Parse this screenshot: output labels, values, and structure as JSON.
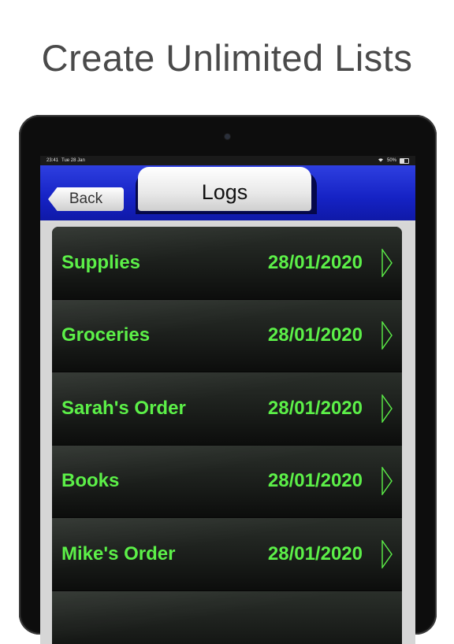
{
  "headline": "Create Unlimited Lists",
  "status_bar": {
    "time": "23:41",
    "date": "Tue 28 Jan",
    "battery": "50%",
    "icons": [
      "wifi-icon",
      "battery-icon"
    ]
  },
  "nav": {
    "back_label": "Back",
    "title": "Logs"
  },
  "lists": [
    {
      "name": "Supplies",
      "date": "28/01/2020"
    },
    {
      "name": "Groceries",
      "date": "28/01/2020"
    },
    {
      "name": "Sarah's Order",
      "date": "28/01/2020"
    },
    {
      "name": "Books",
      "date": "28/01/2020"
    },
    {
      "name": "Mike's Order",
      "date": "28/01/2020"
    },
    {
      "name": "",
      "date": ""
    }
  ],
  "colors": {
    "accent_text": "#5cf048",
    "nav_blue": "#1522c4"
  }
}
